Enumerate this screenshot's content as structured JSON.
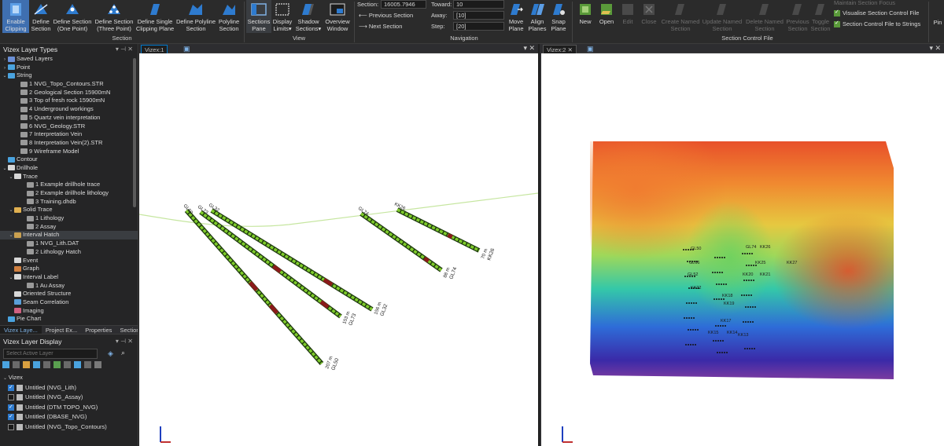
{
  "ribbon": {
    "section_group": {
      "label": "Section",
      "buttons": [
        {
          "line1": "Enable",
          "line2": "Clipping"
        },
        {
          "line1": "Define",
          "line2": "Section"
        },
        {
          "line1": "Define Section",
          "line2": "(One Point)"
        },
        {
          "line1": "Define Section",
          "line2": "(Three Point)"
        },
        {
          "line1": "Define Single",
          "line2": "Clipping Plane"
        },
        {
          "line1": "Define Polyline",
          "line2": "Section"
        },
        {
          "line1": "Polyline",
          "line2": "Section"
        }
      ]
    },
    "view_group": {
      "label": "View",
      "buttons": [
        {
          "line1": "Sections",
          "line2": "Pane"
        },
        {
          "line1": "Display",
          "line2": "Limits▾"
        },
        {
          "line1": "Shadow",
          "line2": "Sections▾"
        },
        {
          "line1": "Overview",
          "line2": "Window"
        }
      ]
    },
    "navigation_group": {
      "label": "Navigation",
      "section_label": "Section:",
      "section_value": "16005.7946",
      "previous_label": "Previous Section",
      "next_label": "Next Section",
      "toward_label": "Toward:",
      "toward_value": "10",
      "away_label": "Away:",
      "away_value": "[10]",
      "step_label": "Step:",
      "step_value": "[20]",
      "move_plane": {
        "line1": "Move",
        "line2": "Plane"
      },
      "align_planes": {
        "line1": "Align",
        "line2": "Planes"
      },
      "snap_plane": {
        "line1": "Snap",
        "line2": "Plane"
      }
    },
    "section_control_group": {
      "label": "Section Control File",
      "buttons": [
        {
          "line1": "New",
          "line2": ""
        },
        {
          "line1": "Open",
          "line2": ""
        },
        {
          "line1": "Edit",
          "line2": ""
        },
        {
          "line1": "Close",
          "line2": ""
        },
        {
          "line1": "Create Named",
          "line2": "Section"
        },
        {
          "line1": "Update Named",
          "line2": "Section"
        },
        {
          "line1": "Delete Named",
          "line2": "Section"
        },
        {
          "line1": "Previous",
          "line2": "Section"
        },
        {
          "line1": "Toggle",
          "line2": "Section"
        }
      ],
      "maintain": "Maintain Section Focus",
      "visualise": "Visualise Section Control File",
      "to_strings": "Section Control File to Strings"
    },
    "pin_label": "Pin"
  },
  "layer_types": {
    "title": "Vizex Layer Types",
    "rows": [
      {
        "label": "Saved Layers",
        "level": 0,
        "toggle": "›",
        "icon": "#6b8fd6"
      },
      {
        "label": "Point",
        "level": 0,
        "toggle": "›",
        "icon": "#4aa3df"
      },
      {
        "label": "String",
        "level": 0,
        "toggle": "⌄",
        "icon": "#4aa3df"
      },
      {
        "label": "1 NVG_Topo_Contours.STR",
        "level": 2,
        "toggle": "",
        "icon": "#9a9a9a"
      },
      {
        "label": "2 Geological Section 15900mN",
        "level": 2,
        "toggle": "",
        "icon": "#9a9a9a"
      },
      {
        "label": "3 Top of fresh rock 15900mN",
        "level": 2,
        "toggle": "",
        "icon": "#9a9a9a"
      },
      {
        "label": "4 Underground workings",
        "level": 2,
        "toggle": "",
        "icon": "#9a9a9a"
      },
      {
        "label": "5 Quartz vein interpretation",
        "level": 2,
        "toggle": "",
        "icon": "#9a9a9a"
      },
      {
        "label": "6 NVG_Geology.STR",
        "level": 2,
        "toggle": "",
        "icon": "#9a9a9a"
      },
      {
        "label": "7 Interpretation Vein",
        "level": 2,
        "toggle": "",
        "icon": "#9a9a9a"
      },
      {
        "label": "8 Interpretation Vein(2).STR",
        "level": 2,
        "toggle": "",
        "icon": "#9a9a9a"
      },
      {
        "label": "9 Wireframe Model",
        "level": 2,
        "toggle": "",
        "icon": "#9a9a9a"
      },
      {
        "label": "Contour",
        "level": 0,
        "toggle": "",
        "icon": "#4aa3df"
      },
      {
        "label": "Drillhole",
        "level": 0,
        "toggle": "⌄",
        "icon": "#d8d8d8"
      },
      {
        "label": "Trace",
        "level": 1,
        "toggle": "⌄",
        "icon": "#d8d8d8"
      },
      {
        "label": "1 Example drillhole trace",
        "level": 3,
        "toggle": "",
        "icon": "#9a9a9a"
      },
      {
        "label": "2 Example drillhole lithology",
        "level": 3,
        "toggle": "",
        "icon": "#9a9a9a"
      },
      {
        "label": "3 Training.dhdb",
        "level": 3,
        "toggle": "",
        "icon": "#9a9a9a"
      },
      {
        "label": "Solid Trace",
        "level": 1,
        "toggle": "⌄",
        "icon": "#e0b050"
      },
      {
        "label": "1 Lithology",
        "level": 3,
        "toggle": "",
        "icon": "#9a9a9a"
      },
      {
        "label": "2 Assay",
        "level": 3,
        "toggle": "",
        "icon": "#9a9a9a"
      },
      {
        "label": "Interval Hatch",
        "level": 1,
        "toggle": "⌄",
        "icon": "#c9a050",
        "selected": true
      },
      {
        "label": "1 NVG_Lith.DAT",
        "level": 3,
        "toggle": "",
        "icon": "#9a9a9a"
      },
      {
        "label": "2 Lithology Hatch",
        "level": 3,
        "toggle": "",
        "icon": "#9a9a9a"
      },
      {
        "label": "Event",
        "level": 1,
        "toggle": "",
        "icon": "#d8d8d8"
      },
      {
        "label": "Graph",
        "level": 1,
        "toggle": "",
        "icon": "#d08040"
      },
      {
        "label": "Interval Label",
        "level": 1,
        "toggle": "⌄",
        "icon": "#d8d8d8"
      },
      {
        "label": "1 Au Assay",
        "level": 3,
        "toggle": "",
        "icon": "#9a9a9a"
      },
      {
        "label": "Oriented Structure",
        "level": 1,
        "toggle": "",
        "icon": "#d8d8d8"
      },
      {
        "label": "Seam Correlation",
        "level": 1,
        "toggle": "",
        "icon": "#5a9fd8"
      },
      {
        "label": "Imaging",
        "level": 1,
        "toggle": "",
        "icon": "#d06080"
      },
      {
        "label": "Pie Chart",
        "level": 0,
        "toggle": "",
        "icon": "#4aa3df"
      }
    ]
  },
  "panel_tabs": [
    "Vizex Laye...",
    "Project Ex...",
    "Properties",
    "Sections"
  ],
  "layer_display": {
    "title": "Vizex Layer Display",
    "search_placeholder": "Select Active Layer",
    "root": "Vizex",
    "layers": [
      {
        "label": "Untitled (NVG_Lith)",
        "checked": true
      },
      {
        "label": "Untitled (NVG_Assay)",
        "checked": false
      },
      {
        "label": "Untitled (DTM TOPO_NVG)",
        "checked": true
      },
      {
        "label": "Untitled (DBASE_NVG)",
        "checked": true
      },
      {
        "label": "Untitled (NVG_Topo_Contours)",
        "checked": false
      }
    ]
  },
  "view1": {
    "tab": "Vizex:1",
    "holes": [
      {
        "name": "GL50",
        "depth": "207 m"
      },
      {
        "name": "GL73",
        "depth": "153 m"
      },
      {
        "name": "GL32",
        "depth": "156 m"
      },
      {
        "name": "GL74",
        "depth": "88 m"
      },
      {
        "name": "KK26",
        "depth": "70 m"
      }
    ]
  },
  "view2": {
    "tab": "Vizex:2",
    "labels": [
      "GL50",
      "GL74",
      "KK26",
      "KK25",
      "KK27",
      "GL66",
      "KK21",
      "GL52",
      "KK20",
      "KK22",
      "KK18",
      "KK19",
      "KK17",
      "KK15",
      "KK14",
      "KK13"
    ]
  }
}
